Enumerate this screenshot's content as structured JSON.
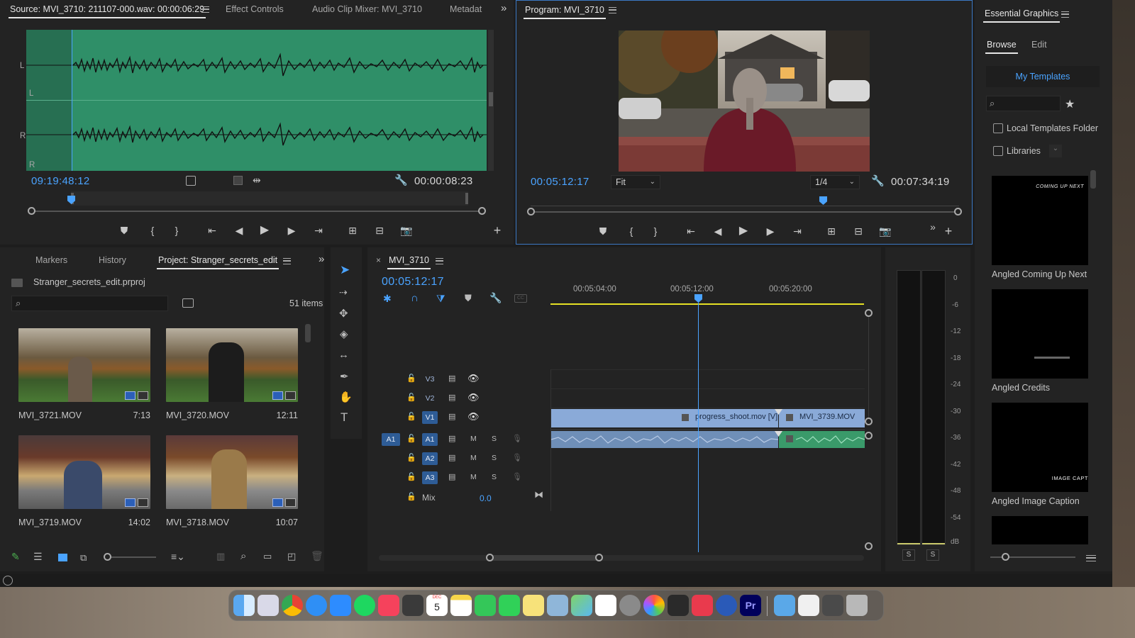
{
  "source_monitor": {
    "tabs": [
      "Source: MVI_3710: 211107-000.wav: 00:00:06:29",
      "Effect Controls",
      "Audio Clip Mixer: MVI_3710",
      "Metadat"
    ],
    "channel_labels": [
      "L",
      "L",
      "R",
      "R"
    ],
    "timecode_left": "09:19:48:12",
    "timecode_right": "00:00:08:23",
    "waveform_color": "#2f8f68"
  },
  "program_monitor": {
    "title": "Program: MVI_3710",
    "timecode_left": "00:05:12:17",
    "fit_label": "Fit",
    "resolution_label": "1/4",
    "timecode_right": "00:07:34:19"
  },
  "project_panel": {
    "tabs": [
      "Markers",
      "History",
      "Project: Stranger_secrets_edit"
    ],
    "project_file": "Stranger_secrets_edit.prproj",
    "items_count": "51 items",
    "clips": [
      {
        "name": "MVI_3721.MOV",
        "duration": "7:13"
      },
      {
        "name": "MVI_3720.MOV",
        "duration": "12:11"
      },
      {
        "name": "MVI_3719.MOV",
        "duration": "14:02"
      },
      {
        "name": "MVI_3718.MOV",
        "duration": "10:07"
      }
    ]
  },
  "timeline": {
    "sequence_tab": "MVI_3710",
    "timecode": "00:05:12:17",
    "ruler_labels": [
      "00:05:04:00",
      "00:05:12:00",
      "00:05:20:00"
    ],
    "video_tracks": [
      "V3",
      "V2",
      "V1"
    ],
    "audio_tracks": [
      "A1",
      "A2",
      "A3"
    ],
    "source_patch": "A1",
    "mute_label": "M",
    "solo_label": "S",
    "mix_label": "Mix",
    "mix_value": "0.0",
    "clips": {
      "video_1": "progress_shoot.mov [V]",
      "video_2": "MVI_3739.MOV"
    }
  },
  "audio_meter": {
    "scale": [
      "0",
      "-6",
      "-12",
      "-18",
      "-24",
      "-30",
      "-36",
      "-42",
      "-48",
      "-54",
      "dB"
    ],
    "solo_buttons": [
      "S",
      "S"
    ]
  },
  "essential_graphics": {
    "title": "Essential Graphics",
    "tabs": [
      "Browse",
      "Edit"
    ],
    "templates_button": "My Templates",
    "checkbox_local": "Local Templates Folder",
    "checkbox_libraries": "Libraries",
    "templates": [
      {
        "label": "Angled Coming Up Next",
        "preview_text": "COMING UP NEXT"
      },
      {
        "label": "Angled Credits",
        "preview_text": ""
      },
      {
        "label": "Angled Image Caption",
        "preview_text": "IMAGE CAPT"
      }
    ]
  },
  "colors": {
    "accent": "#4aa3ff",
    "video_clip": "#8aaad8",
    "audio_clip": "#6f8fb8",
    "audio_clip_green": "#3a9a6a",
    "timeline_bar": "#e6e024"
  },
  "dock": {
    "calendar_month": "DEC",
    "calendar_day": "5",
    "app_label": "Pr"
  }
}
